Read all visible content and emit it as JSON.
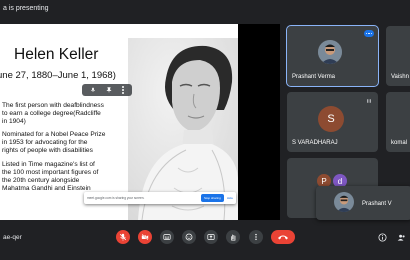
{
  "header": {
    "presenting_text": "a is presenting"
  },
  "slide": {
    "title": "Helen Keller",
    "dates": "une 27, 1880–June 1, 1968)",
    "bullets": [
      "The first person with deafblindness\nto earn a college degree(Radcliffe\nin 1904)",
      "Nominated for a Nobel Peace Prize\nin 1953 for advocating for the\nrights of people with disabilities",
      "Listed in Time magazine's list of\nthe 100 most important figures of\nthe 20th century alongside\nMahatma Gandhi and Einstein"
    ]
  },
  "share_bar": {
    "text": "meet.google.com is sharing your screen.",
    "stop_label": "Stop sharing",
    "hide_label": "Hide"
  },
  "participants": [
    {
      "name": "Prashant Verma",
      "active": true
    },
    {
      "name": "Vaishn"
    },
    {
      "name": "S VARADHARAJ",
      "initial": "S",
      "color": "#8d4b31"
    },
    {
      "name": "komal"
    },
    {
      "initial_p": "P",
      "initial_d": "d",
      "color_p": "#8d4b31",
      "color_d": "#7e57c2"
    },
    {
      "name": "Prashant V"
    }
  ],
  "footer": {
    "meeting_code": "ae-qer"
  },
  "colors": {
    "accent": "#8ab4f8",
    "danger": "#ea4335",
    "tile": "#3c4043",
    "background": "#202124"
  },
  "icons": [
    "mic-off-icon",
    "camera-off-icon",
    "captions-icon",
    "emoji-icon",
    "present-icon",
    "raise-hand-icon",
    "more-options-icon",
    "end-call-icon",
    "info-icon",
    "people-icon"
  ]
}
